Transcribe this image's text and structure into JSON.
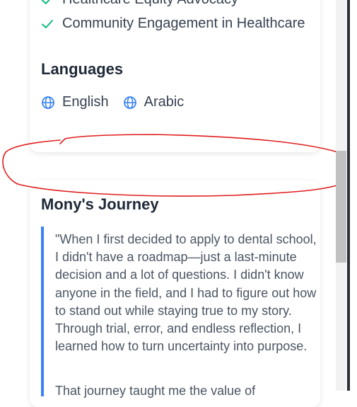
{
  "skills": {
    "items": [
      {
        "label": "Healthcare Equity Advocacy",
        "icon": "check-icon"
      },
      {
        "label": "Community Engagement in Healthcare",
        "icon": "check-icon"
      }
    ]
  },
  "languages": {
    "heading": "Languages",
    "items": [
      {
        "label": "English",
        "icon": "globe-icon"
      },
      {
        "label": "Arabic",
        "icon": "globe-icon"
      }
    ]
  },
  "journey": {
    "title": "Mony's Journey",
    "quote": "\"When I first decided to apply to dental school, I didn't have a roadmap—just a last-minute decision and a lot of questions. I didn't know anyone in the field, and I had to figure out how to stand out while staying true to my story. Through trial, error, and endless reflection, I learned how to turn uncertainty into purpose.",
    "quote_next": "That journey taught me the value of"
  },
  "colors": {
    "accent": "#3b82f6",
    "check": "#10b981",
    "annotation": "#e11d1d",
    "text": "#374151"
  }
}
